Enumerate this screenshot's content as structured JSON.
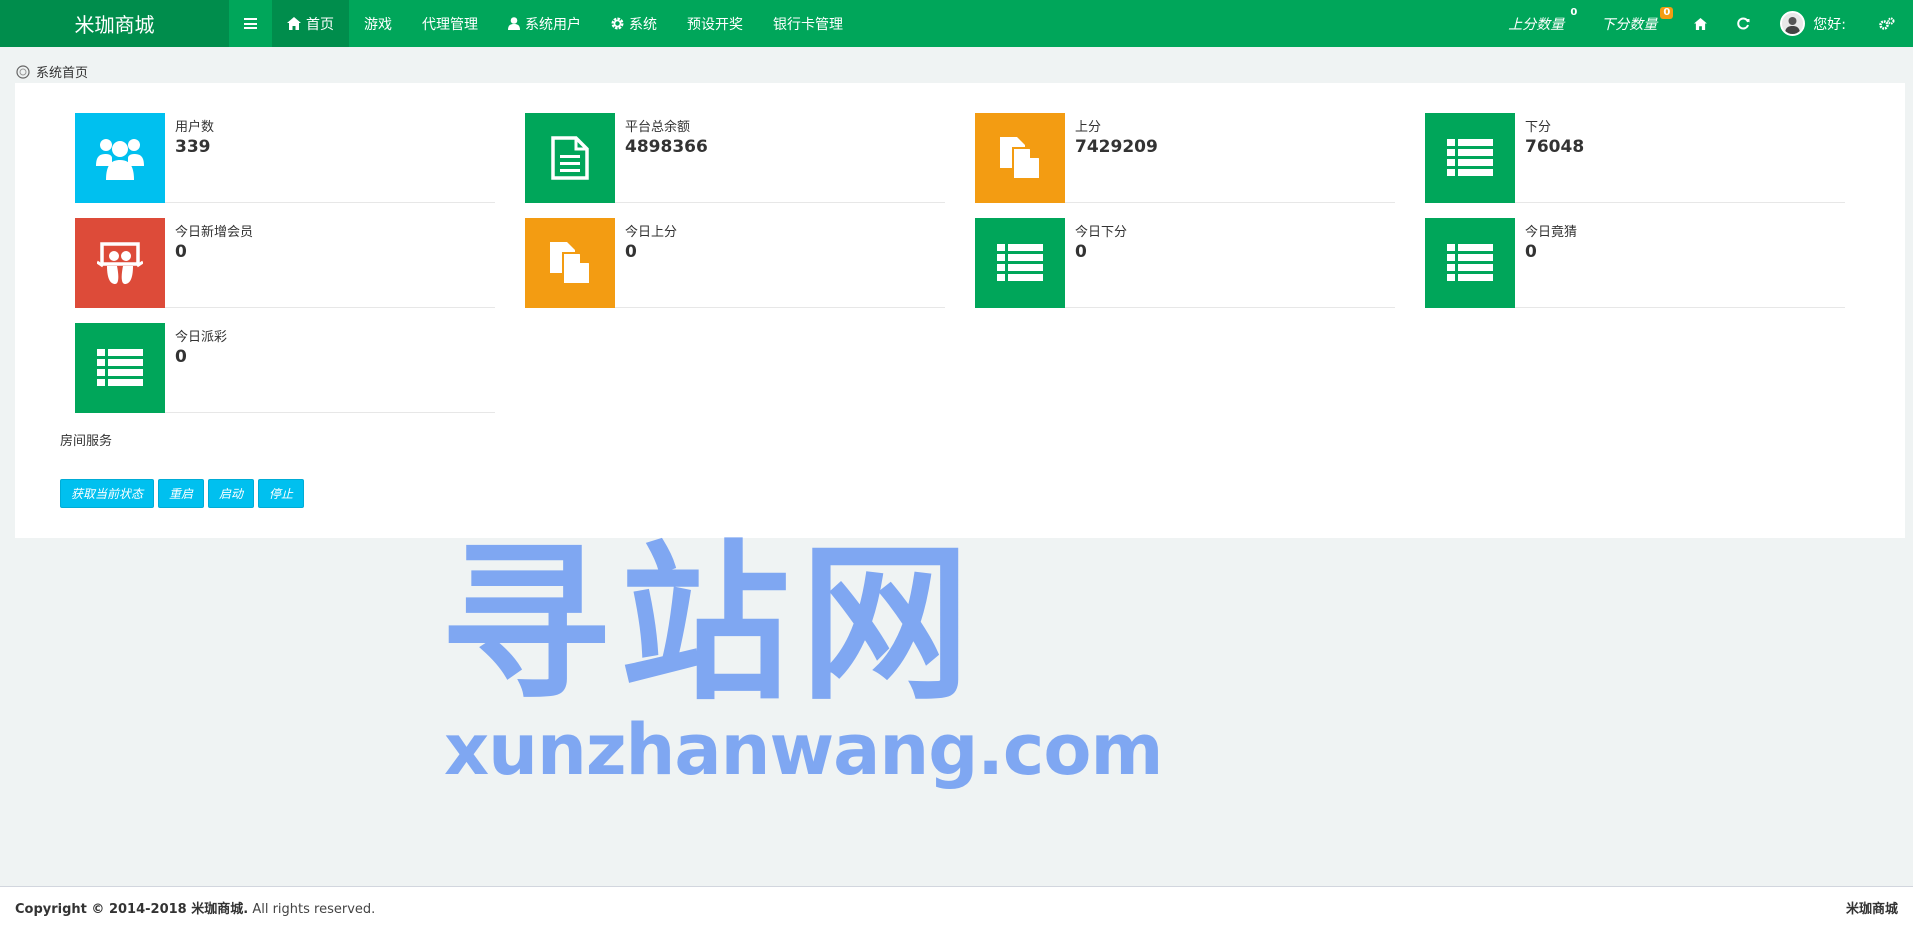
{
  "brand": "米珈商城",
  "nav": {
    "items": [
      {
        "label": "首页",
        "icon": "home-icon",
        "active": true
      },
      {
        "label": "游戏"
      },
      {
        "label": "代理管理"
      },
      {
        "label": "系统用户",
        "icon": "user-icon"
      },
      {
        "label": "系统",
        "icon": "gear-icon"
      },
      {
        "label": "预设开奖"
      },
      {
        "label": "银行卡管理"
      }
    ],
    "right": {
      "up_count_label": "上分数量",
      "up_count_badge": "0",
      "down_count_label": "下分数量",
      "down_count_badge": "0",
      "greeting": "您好:"
    }
  },
  "breadcrumb": "系统首页",
  "stats": [
    {
      "label": "用户数",
      "value": "339",
      "color": "#00c0ef",
      "icon": "users-icon"
    },
    {
      "label": "平台总余额",
      "value": "4898366",
      "color": "#00a65a",
      "icon": "document-icon"
    },
    {
      "label": "上分",
      "value": "7429209",
      "color": "#f39c12",
      "icon": "copy-icon"
    },
    {
      "label": "下分",
      "value": "76048",
      "color": "#00a65a",
      "icon": "list-icon"
    },
    {
      "label": "今日新增会员",
      "value": "0",
      "color": "#dd4b39",
      "icon": "slideshare-icon"
    },
    {
      "label": "今日上分",
      "value": "0",
      "color": "#f39c12",
      "icon": "copy-icon"
    },
    {
      "label": "今日下分",
      "value": "0",
      "color": "#00a65a",
      "icon": "list-icon"
    },
    {
      "label": "今日竟猜",
      "value": "0",
      "color": "#00a65a",
      "icon": "list-icon"
    },
    {
      "label": "今日派彩",
      "value": "0",
      "color": "#00a65a",
      "icon": "list-icon"
    }
  ],
  "room_service": {
    "title": "房间服务",
    "buttons": [
      "获取当前状态",
      "重启",
      "启动",
      "停止"
    ]
  },
  "watermark": {
    "cn": "寻站网",
    "en": "xunzhanwang.com"
  },
  "footer": {
    "copyright_prefix": "Copyright © 2014-2018 ",
    "company": "米珈商城.",
    "rights": " All rights reserved.",
    "right_text": "米珈商城"
  }
}
